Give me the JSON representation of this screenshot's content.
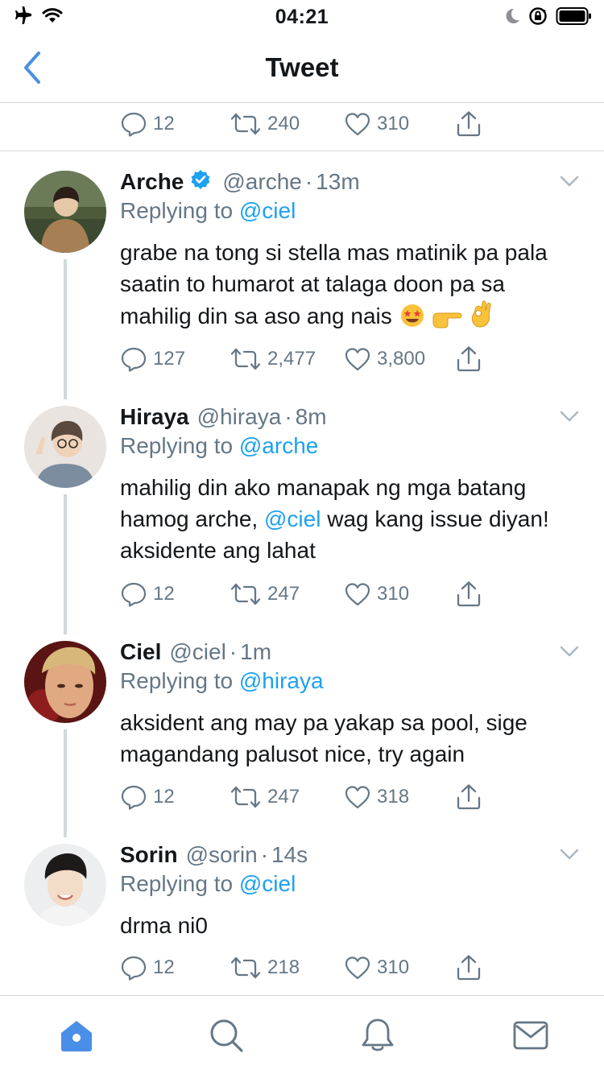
{
  "status_bar": {
    "time": "04:21",
    "left_icons": [
      "airplane-icon",
      "wifi-icon"
    ],
    "right_icons": [
      "moon-icon",
      "orientation-lock-icon",
      "battery-icon"
    ]
  },
  "header": {
    "title": "Tweet",
    "back_icon": "chevron-left-icon"
  },
  "top_actions": {
    "replies": "12",
    "retweets": "240",
    "likes": "310"
  },
  "tweets": [
    {
      "name": "Arche",
      "verified": true,
      "handle": "@arche",
      "dot": "·",
      "time": "13m",
      "replying_prefix": "Replying to",
      "replying_to": "@ciel",
      "text": "grabe na tong si stella mas matinik pa pala saatin to humarot at talaga doon pa sa mahilig din sa aso ang nais",
      "emojis": [
        "star-struck-emoji",
        "pointing-right-emoji",
        "ok-hand-emoji"
      ],
      "replies": "127",
      "retweets": "2,477",
      "likes": "3,800"
    },
    {
      "name": "Hiraya",
      "verified": false,
      "handle": "@hiraya",
      "dot": "·",
      "time": "8m",
      "replying_prefix": "Replying to",
      "replying_to": "@arche",
      "text_before": "mahilig din ako manapak ng mga batang hamog arche,",
      "text_mention": "@ciel",
      "text_after": "wag kang issue diyan! aksidente ang lahat",
      "replies": "12",
      "retweets": "247",
      "likes": "310"
    },
    {
      "name": "Ciel",
      "verified": false,
      "handle": "@ciel",
      "dot": "·",
      "time": "1m",
      "replying_prefix": "Replying to",
      "replying_to": "@hiraya",
      "text": "aksident ang may pa yakap sa pool, sige magandang palusot nice, try again",
      "replies": "12",
      "retweets": "247",
      "likes": "318"
    },
    {
      "name": "Sorin",
      "verified": false,
      "handle": "@sorin",
      "dot": "·",
      "time": "14s",
      "replying_prefix": "Replying to",
      "replying_to": "@ciel",
      "text": "drma ni0",
      "replies": "12",
      "retweets": "218",
      "likes": "310"
    }
  ],
  "tabbar": {
    "items": [
      "home-icon",
      "search-icon",
      "notifications-icon",
      "messages-icon"
    ],
    "active": "home-icon"
  },
  "colors": {
    "accent": "#1da1f2",
    "muted": "#657786",
    "text": "#14171a",
    "divider": "#d6d6d8",
    "back_arrow": "#4a90e2",
    "home_active": "#4a8fe7"
  }
}
